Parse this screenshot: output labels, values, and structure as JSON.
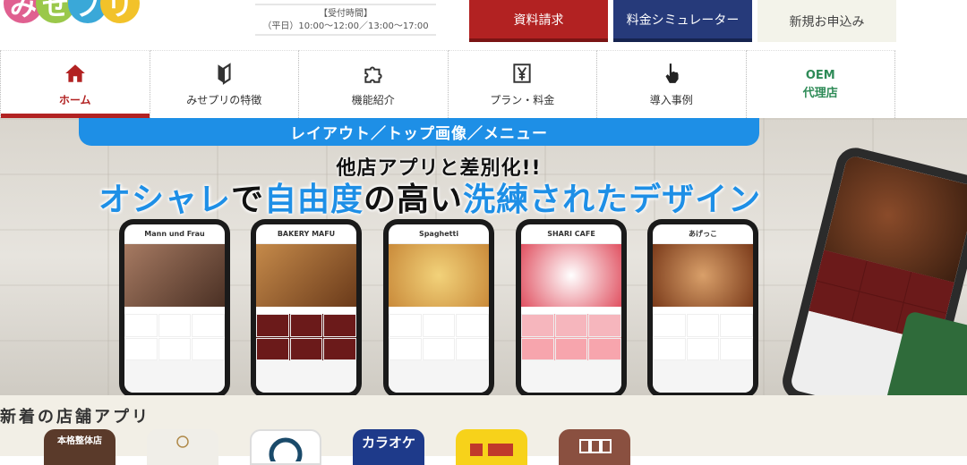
{
  "logo": {
    "text": "みせプリ",
    "alt": "misepri-logo"
  },
  "header": {
    "hours_title": "【受付時間】",
    "hours_text": "（平日）10:00～12:00／13:00～17:00",
    "request_label": "資料請求",
    "simulator_label": "料金シミュレーター",
    "apply_label": "新規お申込み"
  },
  "nav": {
    "home": "ホーム",
    "features": "みせプリの特徴",
    "functions": "機能紹介",
    "plans": "プラン・料金",
    "cases": "導入事例",
    "oem_line1": "OEM",
    "oem_line2": "代理店"
  },
  "hero": {
    "ribbon": "レイアウト／トップ画像／メニュー",
    "subtitle": "他店アプリと差別化!!",
    "main_1": "オシャレ",
    "main_2": "で",
    "main_3": "自由度",
    "main_4": "の高い",
    "main_5": "洗練された",
    "main_6": "デザイン",
    "phones": [
      {
        "name": "Mann und Frau",
        "color": "#7a5a48"
      },
      {
        "name": "BAKERY MAFU",
        "color": "#8a5a32"
      },
      {
        "name": "Spaghetti",
        "color": "#d9b06a"
      },
      {
        "name": "SHARI CAFE",
        "color": "#e88c96"
      },
      {
        "name": "あげっこ",
        "color": "#b77a4a"
      }
    ]
  },
  "apps": {
    "title": "新着の店舗アプリ",
    "icons": [
      {
        "label": "本格整体店",
        "bg": "#5a3a2a",
        "fg": "#fff"
      },
      {
        "label": "",
        "bg": "#f0eee8",
        "fg": "#b08a4a"
      },
      {
        "label": "",
        "bg": "#ffffff",
        "fg": "#1a4a6a"
      },
      {
        "label": "カラオケ",
        "bg": "#1e3a8a",
        "fg": "#fff"
      },
      {
        "label": "",
        "bg": "#f7d21a",
        "fg": "#c0392b"
      },
      {
        "label": "",
        "bg": "#8a5040",
        "fg": "#fff"
      }
    ]
  }
}
